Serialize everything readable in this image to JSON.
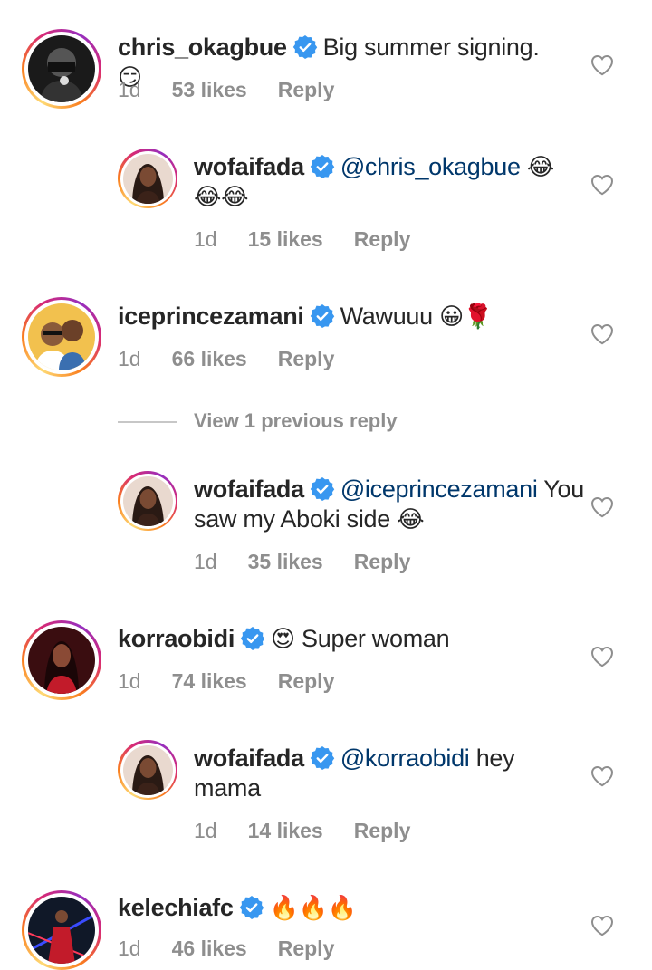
{
  "comments": [
    {
      "username": "chris_okagbue",
      "text": "Big summer signing.",
      "emoji": "😏",
      "time": "1d",
      "likes": "53 likes",
      "reply": "Reply"
    },
    {
      "username": "wofaifada",
      "mention": "@chris_okagbue",
      "emoji": "😂",
      "emoji2": "😂😂",
      "time": "1d",
      "likes": "15 likes",
      "reply": "Reply"
    },
    {
      "username": "iceprincezamani",
      "text": "Wawuuu",
      "emoji": "😀🌹",
      "time": "1d",
      "likes": "66 likes",
      "reply": "Reply"
    },
    {
      "username": "wofaifada",
      "mention": "@iceprincezamani",
      "text": "You",
      "text2": "saw my Aboki side",
      "emoji": "😂",
      "time": "1d",
      "likes": "35 likes",
      "reply": "Reply"
    },
    {
      "username": "korraobidi",
      "emoji": "😍",
      "text": "Super woman",
      "time": "1d",
      "likes": "74 likes",
      "reply": "Reply"
    },
    {
      "username": "wofaifada",
      "mention": "@korraobidi",
      "text": "hey",
      "text2": "mama",
      "time": "1d",
      "likes": "14 likes",
      "reply": "Reply"
    },
    {
      "username": "kelechiafc",
      "emoji": "🔥🔥🔥",
      "time": "1d",
      "likes": "46 likes",
      "reply": "Reply"
    }
  ],
  "view_previous": "View 1 previous reply",
  "colors": {
    "text": "#262626",
    "mention": "#00376b",
    "meta": "#8e8e8e",
    "verified": "#3897f0"
  }
}
